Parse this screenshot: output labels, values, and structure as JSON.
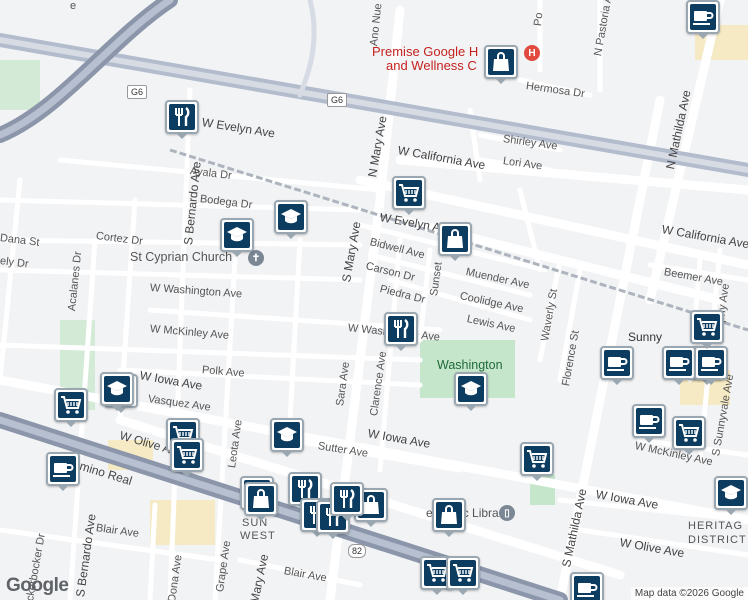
{
  "map": {
    "colors": {
      "background": "#f2f3f5",
      "road": "#ffffff",
      "freeway": "#9aa3b7",
      "park": "#c6e6cc",
      "school": "#f6eac4",
      "pin_icon": "#0d3c61",
      "pin_border": "#9aa7b1",
      "hospital": "#e04a3f"
    },
    "streets": {
      "w_evelyn_1": "W Evelyn Ave",
      "w_evelyn_2": "W Evelyn Ave",
      "n_mary": "N Mary Ave",
      "s_mary_1": "S Mary Ave",
      "s_mary_2": "Mary Ave",
      "w_california_1": "W California Ave",
      "w_california_2": "W California Ave",
      "ayala": "Ayala Dr",
      "bodega": "Bodega Dr",
      "cortez": "Cortez Dr",
      "dana": "Dana St",
      "ely": "ely Dr",
      "bidwell": "Bidwell Ave",
      "carson": "Carson Dr",
      "piedra": "Piedra Dr",
      "sunset": "Sunset",
      "muender": "Muender Ave",
      "coolidge": "Coolidge Ave",
      "lewis": "Lewis Ave",
      "w_washington_1": "W Washington Ave",
      "w_washington_2": "W Washington Ave",
      "w_mckinley_1": "W McKinley Ave",
      "w_mckinley_2": "W McKinley Ave",
      "polk": "Polk Ave",
      "w_iowa_1": "W Iowa Ave",
      "w_iowa_2": "W Iowa Ave",
      "w_iowa_3": "W Iowa Ave",
      "vasquez": "Vasquez Ave",
      "w_olive_1": "W Olive Ave",
      "w_olive_2": "W Olive Ave",
      "el_camino": "El Camino Real",
      "sutter": "Sutter Ave",
      "leota": "Leota Ave",
      "sara": "Sara Ave",
      "clarence": "Clarence Ave",
      "s_bernardo_1": "S Bernardo Ave",
      "s_bernardo_2": "S Bernardo Ave",
      "acalanes": "Acalanes Dr",
      "blair_1": "Blair Ave",
      "blair_2": "Blair Ave",
      "dona": "Dona Ave",
      "grape": "Grape Ave",
      "knickerbocker": "ckerbocker Dr",
      "shirley": "Shirley Ave",
      "lori": "Lori Ave",
      "hermosa": "Hermosa Dr",
      "n_mathilda": "N Mathilda Ave",
      "n_pastoria": "N Pastoria Ave",
      "s_mathilda": "S Mathilda Ave",
      "florence": "Florence St",
      "waverly": "Waverly St",
      "beemer": "Beemer Ave",
      "murphy": "Murphy Ave",
      "s_sunnyvale": "S Sunnyvale Ave",
      "w_mckinley_e": "W McKinley Ave",
      "ano_nue": "Ano Nue",
      "po": "Po",
      "e_partial": "e"
    },
    "shields": {
      "g6_a": "G6",
      "g6_b": "G6",
      "r82": "82"
    },
    "places": {
      "hospital": "Premise Google Health and Wellness Center",
      "hospital_line1": "Premise Google H",
      "hospital_line2": "and Wellness C",
      "church": "St Cyprian Church",
      "washington": "Washington",
      "library": "e Public Library",
      "sunny": "Sunny",
      "west": "WEST",
      "sun": "SUN",
      "heritage_1": "HERITAG",
      "heritage_2": "DISTRICT"
    },
    "footer": {
      "logo": "Google",
      "credit": "Map data ©2026 Google"
    },
    "pins": [
      {
        "type": "restaurant-icon"
      },
      {
        "type": "school-icon"
      },
      {
        "type": "school-icon"
      },
      {
        "type": "shopping-cart-icon"
      },
      {
        "type": "shopping-bag-icon"
      },
      {
        "type": "shopping-bag-icon"
      },
      {
        "type": "coffee-icon"
      },
      {
        "type": "restaurant-icon"
      },
      {
        "type": "school-icon"
      },
      {
        "type": "shopping-cart-icon"
      },
      {
        "type": "school-icon"
      },
      {
        "type": "shopping-cart-icon"
      },
      {
        "type": "coffee-icon"
      },
      {
        "type": "coffee-icon"
      },
      {
        "type": "coffee-icon"
      },
      {
        "type": "coffee-icon"
      },
      {
        "type": "shopping-cart-icon"
      },
      {
        "type": "school-icon"
      },
      {
        "type": "restaurant-icon"
      },
      {
        "type": "shopping-bag-icon"
      },
      {
        "type": "shopping-cart-icon"
      },
      {
        "type": "school-icon"
      },
      {
        "type": "shopping-bag-icon"
      },
      {
        "type": "shopping-bag-icon"
      },
      {
        "type": "shopping-cart-icon"
      },
      {
        "type": "shopping-cart-icon"
      },
      {
        "type": "coffee-icon"
      },
      {
        "type": "coffee-icon"
      },
      {
        "type": "school-icon"
      },
      {
        "type": "restaurant-icon"
      },
      {
        "type": "restaurant-icon"
      },
      {
        "type": "restaurant-icon"
      },
      {
        "type": "shopping-cart-icon"
      },
      {
        "type": "shopping-bag-icon"
      },
      {
        "type": "coffee-icon"
      },
      {
        "type": "shopping-cart-icon"
      }
    ]
  }
}
